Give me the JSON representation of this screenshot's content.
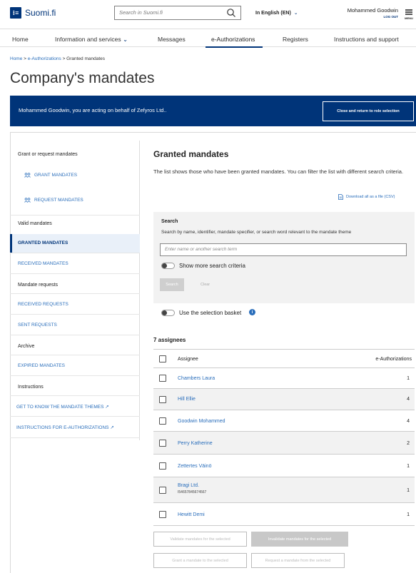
{
  "header": {
    "logo_mark": "⁝≡",
    "logo_text": "Suomi.fi",
    "search_placeholder": "Search in Suomi.fi",
    "language": "In English (EN)",
    "user_name": "Mohammed Goodwin",
    "logout": "LOG OUT",
    "menu_label": "MENU"
  },
  "nav": {
    "items": [
      "Home",
      "Information and services",
      "Messages",
      "e-Authorizations",
      "Registers",
      "Instructions and support"
    ],
    "active": "e-Authorizations"
  },
  "breadcrumb": {
    "home": "Home",
    "sep": ">",
    "eauth": "e-Authorizations",
    "current": "Granted mandates"
  },
  "page_title": "Company's mandates",
  "banner": {
    "text": "Mohammed Goodwin, you are acting on behalf of Zefyros Ltd..",
    "button": "Close and return to role selection"
  },
  "sidebar": {
    "grant_head": "Grant or request mandates",
    "grant_mandates": "GRANT MANDATES",
    "request_mandates": "REQUEST MANDATES",
    "valid_head": "Valid mandates",
    "granted": "GRANTED MANDATES",
    "received": "RECEIVED MANDATES",
    "requests_head": "Mandate requests",
    "received_requests": "RECEIVED REQUESTS",
    "sent_requests": "SENT REQUESTS",
    "archive_head": "Archive",
    "expired": "EXPIRED MANDATES",
    "instructions_head": "Instructions",
    "themes": "GET TO KNOW THE MANDATE THEMES",
    "instructions": "INSTRUCTIONS FOR E-AUTHORIZATIONS"
  },
  "main": {
    "title": "Granted mandates",
    "description": "The list shows those who have been granted mandates. You can filter the list with different search criteria.",
    "csv": "Download all as a file (CSV)"
  },
  "search_panel": {
    "title": "Search",
    "description": "Search by name, identifier, mandate specifier, or search word relevant to the mandate theme",
    "placeholder": "Enter name or another search term",
    "more_criteria": "Show more search criteria",
    "search_btn": "Search",
    "clear_btn": "Clear"
  },
  "basket": {
    "label": "Use the selection basket",
    "info": "i"
  },
  "table": {
    "count": "7 assignees",
    "col_assignee": "Assignee",
    "col_eauth": "e-Authorizations",
    "rows": [
      {
        "name": "Chambers Laura",
        "sub": "",
        "value": "1"
      },
      {
        "name": "Hill Ellie",
        "sub": "",
        "value": "4"
      },
      {
        "name": "Goodwin Mohammed",
        "sub": "",
        "value": "4"
      },
      {
        "name": "Perry Katherine",
        "sub": "",
        "value": "2"
      },
      {
        "name": "Zettertes Väinö",
        "sub": "",
        "value": "1"
      },
      {
        "name": "Bragi Ltd.",
        "sub": "I54657845674567",
        "value": "1"
      },
      {
        "name": "Hewitt Demi",
        "sub": "",
        "value": "1"
      }
    ]
  },
  "actions": {
    "validate": "Validate mandates for the selected",
    "invalidate": "Invalidate mandates for the selected",
    "grant": "Grant a mandate to the selected",
    "request": "Request a mandate from the selected"
  },
  "colors": {
    "brand": "#003479",
    "link": "#2a6ebb",
    "panel": "#f2f2f2"
  }
}
